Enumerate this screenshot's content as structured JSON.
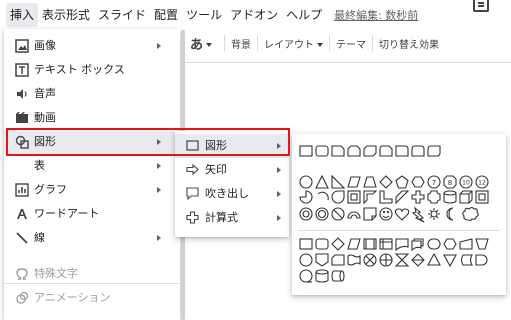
{
  "menubar": {
    "items": [
      "挿入",
      "表示形式",
      "スライド",
      "配置",
      "ツール",
      "アドオン",
      "ヘルプ"
    ],
    "last_edit": "最終編集: 数秒前"
  },
  "toolbar": {
    "font_glyph": "あ",
    "background": "背景",
    "layout": "レイアウト",
    "theme": "テーマ",
    "transition": "切り替え効果"
  },
  "insert_menu": {
    "items": [
      {
        "label": "画像",
        "icon": "image-icon",
        "submenu": true
      },
      {
        "label": "テキスト ボックス",
        "icon": "textbox-icon",
        "submenu": false
      },
      {
        "label": "音声",
        "icon": "audio-icon",
        "submenu": false
      },
      {
        "label": "動画",
        "icon": "video-icon",
        "submenu": false
      },
      {
        "label": "図形",
        "icon": "shape-icon",
        "submenu": true,
        "highlighted": true
      },
      {
        "label": "表",
        "icon": "",
        "submenu": true
      },
      {
        "label": "グラフ",
        "icon": "chart-icon",
        "submenu": true
      },
      {
        "label": "ワードアート",
        "icon": "wordart-icon",
        "submenu": false
      },
      {
        "label": "線",
        "icon": "line-icon",
        "submenu": true
      },
      {
        "label": "特殊文字",
        "icon": "omega-icon",
        "disabled": true
      },
      {
        "label": "アニメーション",
        "icon": "animation-icon",
        "disabled": true
      }
    ]
  },
  "shape_submenu": {
    "items": [
      {
        "label": "図形",
        "icon": "rectangle-icon",
        "highlighted": true
      },
      {
        "label": "矢印",
        "icon": "arrow-icon"
      },
      {
        "label": "吹き出し",
        "icon": "callout-icon"
      },
      {
        "label": "計算式",
        "icon": "plus-icon"
      }
    ]
  },
  "colors": {
    "highlight_border": "#e0161b",
    "hover_bg": "#e8eaed",
    "text": "#202124",
    "disabled_text": "#9aa0a6"
  }
}
